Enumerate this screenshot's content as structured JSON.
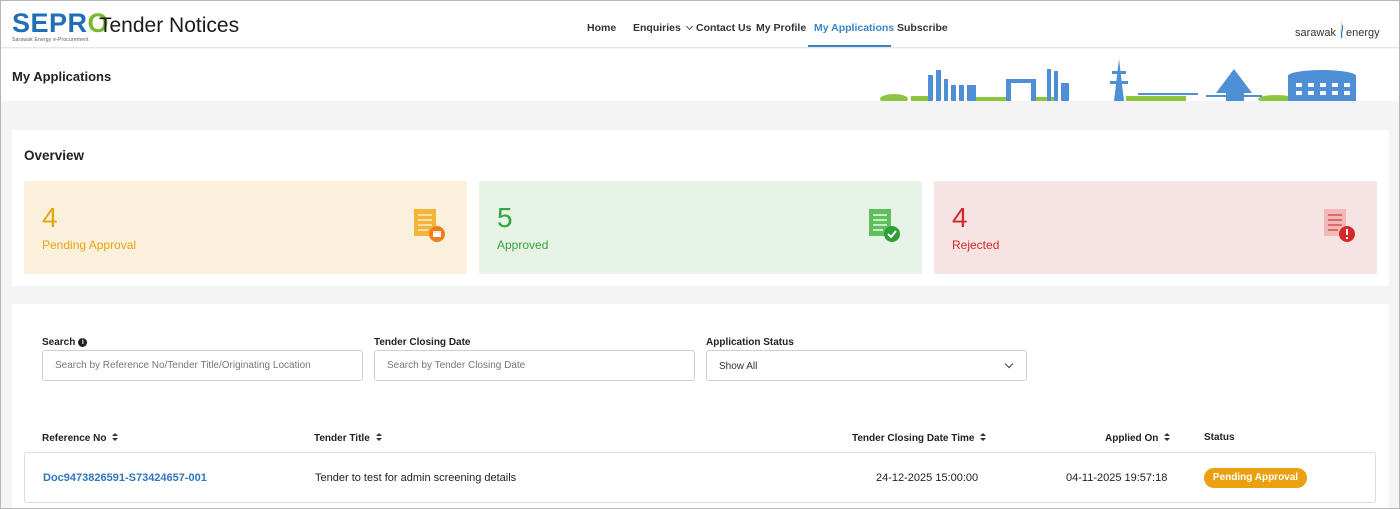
{
  "header": {
    "logo_text": "SEPRO",
    "logo_subtitle": "Sarawak Energy e-Procurement",
    "site_title": "Tender Notices",
    "brand_left": "sarawak",
    "brand_right": "energy"
  },
  "nav": {
    "items": [
      {
        "label": "Home"
      },
      {
        "label": "Enquiries"
      },
      {
        "label": "Contact Us"
      },
      {
        "label": "My Profile"
      },
      {
        "label": "My Applications",
        "active": true
      },
      {
        "label": "Subscribe"
      }
    ]
  },
  "page": {
    "title": "My Applications"
  },
  "overview": {
    "title": "Overview",
    "stats": [
      {
        "count": "4",
        "label": "Pending Approval",
        "color": "#e7a414",
        "icon": "pending-document-icon"
      },
      {
        "count": "5",
        "label": "Approved",
        "color": "#36a63c",
        "icon": "approved-document-icon"
      },
      {
        "count": "4",
        "label": "Rejected",
        "color": "#d32929",
        "icon": "rejected-document-icon"
      }
    ]
  },
  "filters": {
    "search_label": "Search",
    "search_placeholder": "Search by Reference No/Tender Title/Originating Location",
    "date_label": "Tender Closing Date",
    "date_placeholder": "Search by Tender Closing Date",
    "status_label": "Application Status",
    "status_value": "Show All"
  },
  "table": {
    "columns": [
      "Reference No",
      "Tender Title",
      "Tender Closing Date Time",
      "Applied On",
      "Status"
    ],
    "rows": [
      {
        "ref": "Doc9473826591-S73424657-001",
        "title": "Tender to test for admin screening details",
        "closing": "24-12-2025 15:00:00",
        "applied": "04-11-2025 19:57:18",
        "status": "Pending Approval"
      }
    ]
  },
  "colors": {
    "accent": "#3b84c5",
    "pending": "#eba010"
  }
}
